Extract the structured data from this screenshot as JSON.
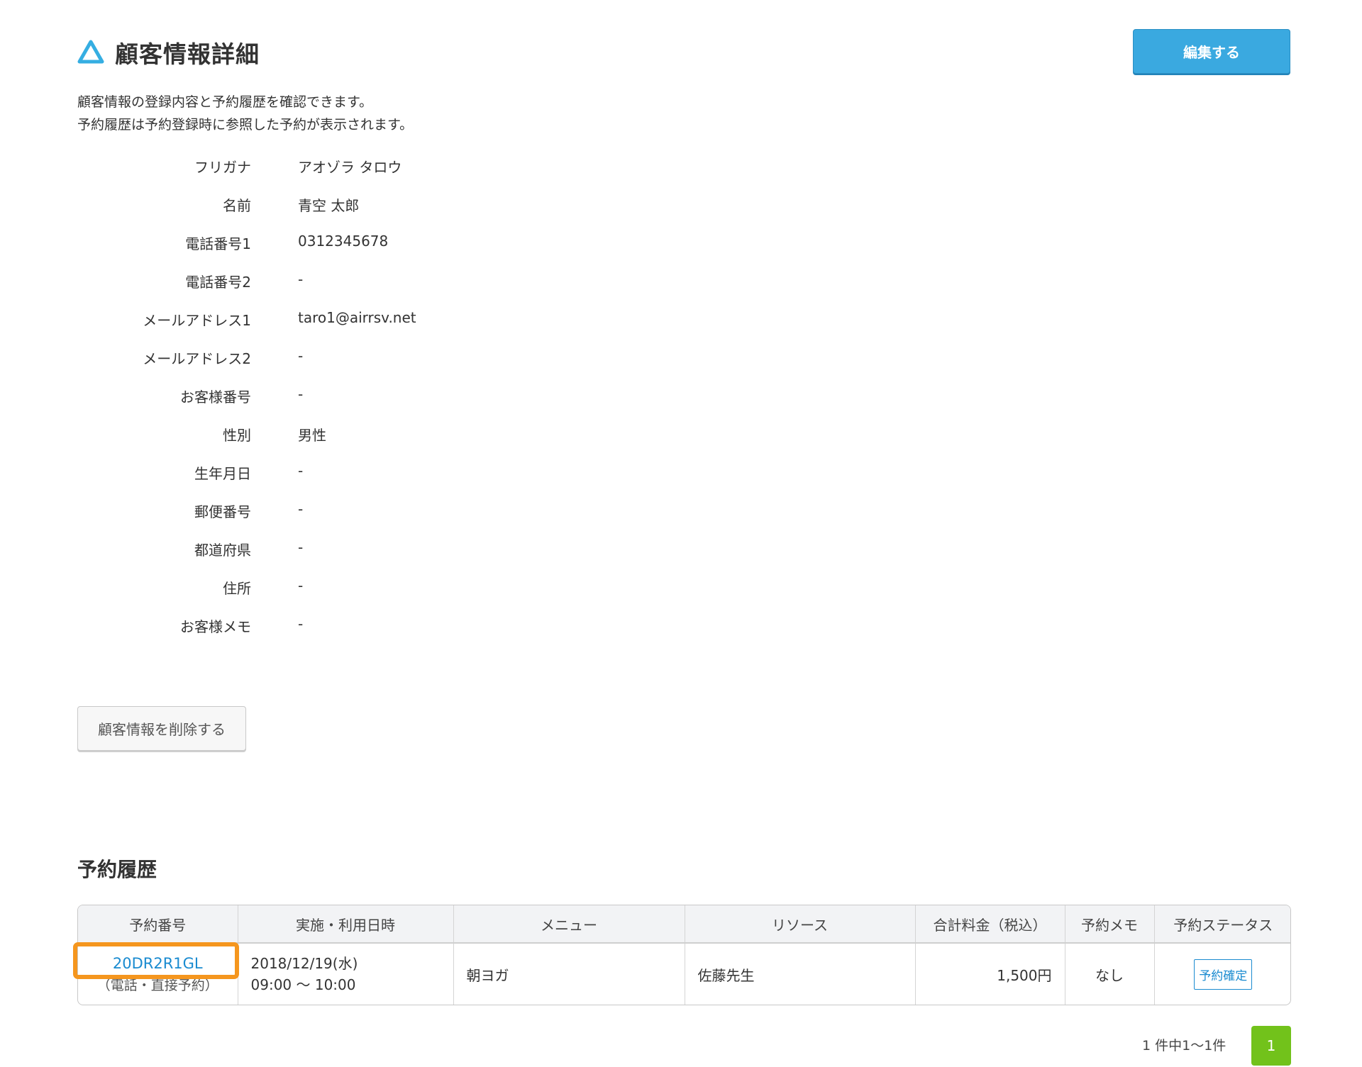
{
  "header": {
    "title": "顧客情報詳細",
    "edit_button_label": "編集する",
    "brand_color": "#3aa9e0"
  },
  "description": {
    "line1": "顧客情報の登録内容と予約履歴を確認できます。",
    "line2": "予約履歴は予約登録時に参照した予約が表示されます。"
  },
  "customer": {
    "fields": [
      {
        "label": "フリガナ",
        "value": "アオゾラ タロウ"
      },
      {
        "label": "名前",
        "value": "青空 太郎"
      },
      {
        "label": "電話番号1",
        "value": "0312345678"
      },
      {
        "label": "電話番号2",
        "value": "-"
      },
      {
        "label": "メールアドレス1",
        "value": "taro1@airrsv.net"
      },
      {
        "label": "メールアドレス2",
        "value": "-"
      },
      {
        "label": "お客様番号",
        "value": "-"
      },
      {
        "label": "性別",
        "value": "男性"
      },
      {
        "label": "生年月日",
        "value": "-"
      },
      {
        "label": "郵便番号",
        "value": "-"
      },
      {
        "label": "都道府県",
        "value": "-"
      },
      {
        "label": "住所",
        "value": "-"
      },
      {
        "label": "お客様メモ",
        "value": "-"
      }
    ]
  },
  "delete_button_label": "顧客情報を削除する",
  "history": {
    "title": "予約履歴",
    "columns": [
      "予約番号",
      "実施・利用日時",
      "メニュー",
      "リソース",
      "合計料金（税込）",
      "予約メモ",
      "予約ステータス"
    ],
    "rows": [
      {
        "reservation_number": "20DR2R1GL",
        "route": "（電話・直接予約）",
        "date": "2018/12/19(水)",
        "time": "09:00 〜 10:00",
        "menu": "朝ヨガ",
        "resource": "佐藤先生",
        "total": "1,500円",
        "memo": "なし",
        "status": "予約確定"
      }
    ]
  },
  "pagination": {
    "info": "1 件中1〜1件",
    "current_page": "1",
    "active_color": "#72c21b"
  },
  "highlight_color": "#f5961e"
}
